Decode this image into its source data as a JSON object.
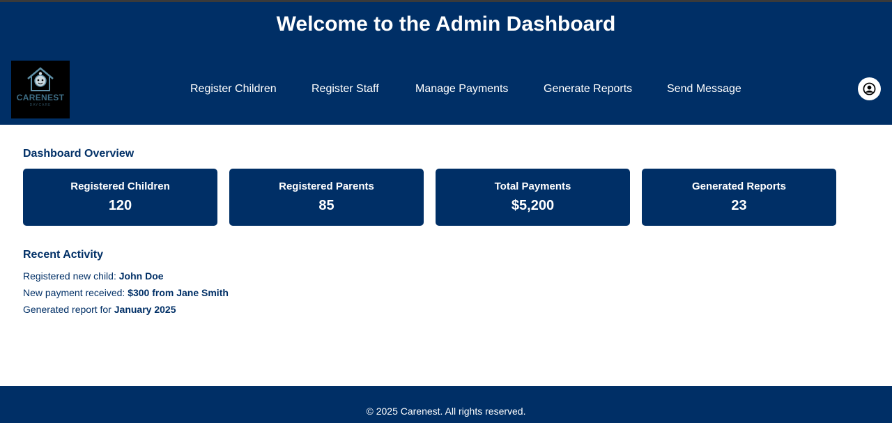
{
  "header": {
    "title": "Welcome to the Admin Dashboard",
    "logo": {
      "name": "CARENEST",
      "sub": "DAYCARE"
    },
    "nav": [
      "Register Children",
      "Register Staff",
      "Manage Payments",
      "Generate Reports",
      "Send Message"
    ],
    "profile_icon": "user-circle-icon"
  },
  "overview": {
    "title": "Dashboard Overview",
    "cards": [
      {
        "label": "Registered Children",
        "value": "120"
      },
      {
        "label": "Registered Parents",
        "value": "85"
      },
      {
        "label": "Total Payments",
        "value": "$5,200"
      },
      {
        "label": "Generated Reports",
        "value": "23"
      }
    ]
  },
  "activity": {
    "title": "Recent Activity",
    "items": [
      {
        "text": "Registered new child: ",
        "highlight": "John Doe"
      },
      {
        "text": "New payment received: ",
        "highlight": "$300 from Jane Smith"
      },
      {
        "text": "Generated report for ",
        "highlight": "January 2025"
      }
    ]
  },
  "footer": {
    "text": "© 2025 Carenest. All rights reserved."
  },
  "colors": {
    "primary": "#002f66",
    "background": "#ffffff",
    "text_on_primary": "#ffffff"
  }
}
